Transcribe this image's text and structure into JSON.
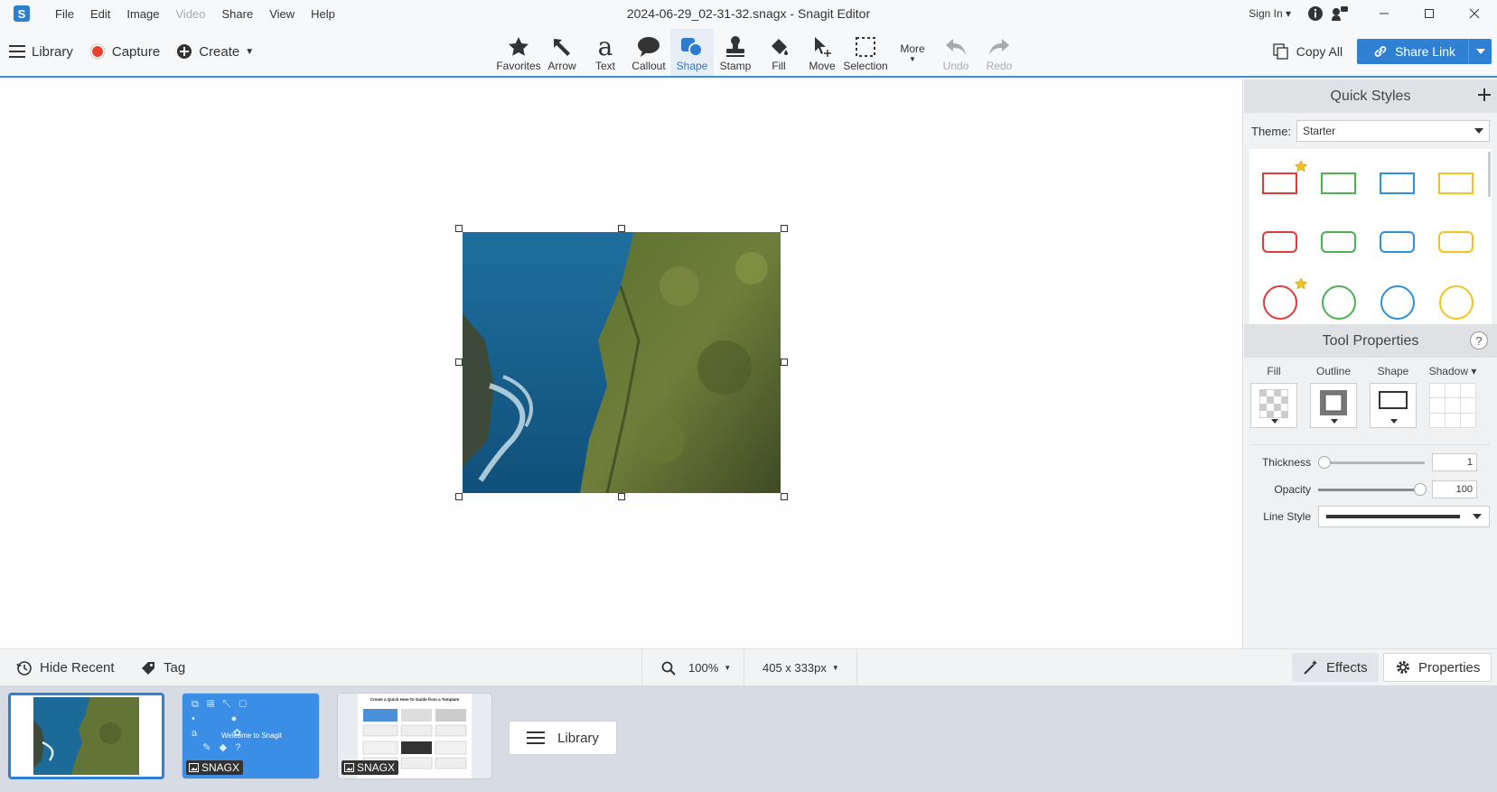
{
  "window": {
    "title": "2024-06-29_02-31-32.snagx - Snagit Editor",
    "menu": [
      "File",
      "Edit",
      "Image",
      "Video",
      "Share",
      "View",
      "Help"
    ],
    "sign_in": "Sign In"
  },
  "toolbar": {
    "library": "Library",
    "capture": "Capture",
    "create": "Create",
    "tools": [
      "Favorites",
      "Arrow",
      "Text",
      "Callout",
      "Shape",
      "Stamp",
      "Fill",
      "Move",
      "Selection",
      "More",
      "Undo",
      "Redo"
    ],
    "active_tool": "Shape",
    "copy_all": "Copy All",
    "share_link": "Share Link",
    "accent_color": "#2f7fd3"
  },
  "quick_styles": {
    "header": "Quick Styles",
    "theme_label": "Theme:",
    "theme_value": "Starter",
    "style_colors": [
      "#e03a3a",
      "#4caf50",
      "#2d8fe0",
      "#f2c21f"
    ]
  },
  "tool_properties": {
    "header": "Tool Properties",
    "help": "?",
    "columns": [
      "Fill",
      "Outline",
      "Shape",
      "Shadow"
    ],
    "thickness_label": "Thickness",
    "thickness_value": "1",
    "opacity_label": "Opacity",
    "opacity_value": "100",
    "line_style_label": "Line Style"
  },
  "bottom_bar": {
    "hide_recent": "Hide Recent",
    "tag": "Tag",
    "zoom": "100%",
    "dimensions": "405 x 333px",
    "effects": "Effects",
    "properties": "Properties"
  },
  "tray": {
    "thumb2_text": "Welcome to Snagit",
    "thumb3_text": "Create a Quick How-To Guide from a Template",
    "badge": "SNAGX",
    "library": "Library"
  }
}
